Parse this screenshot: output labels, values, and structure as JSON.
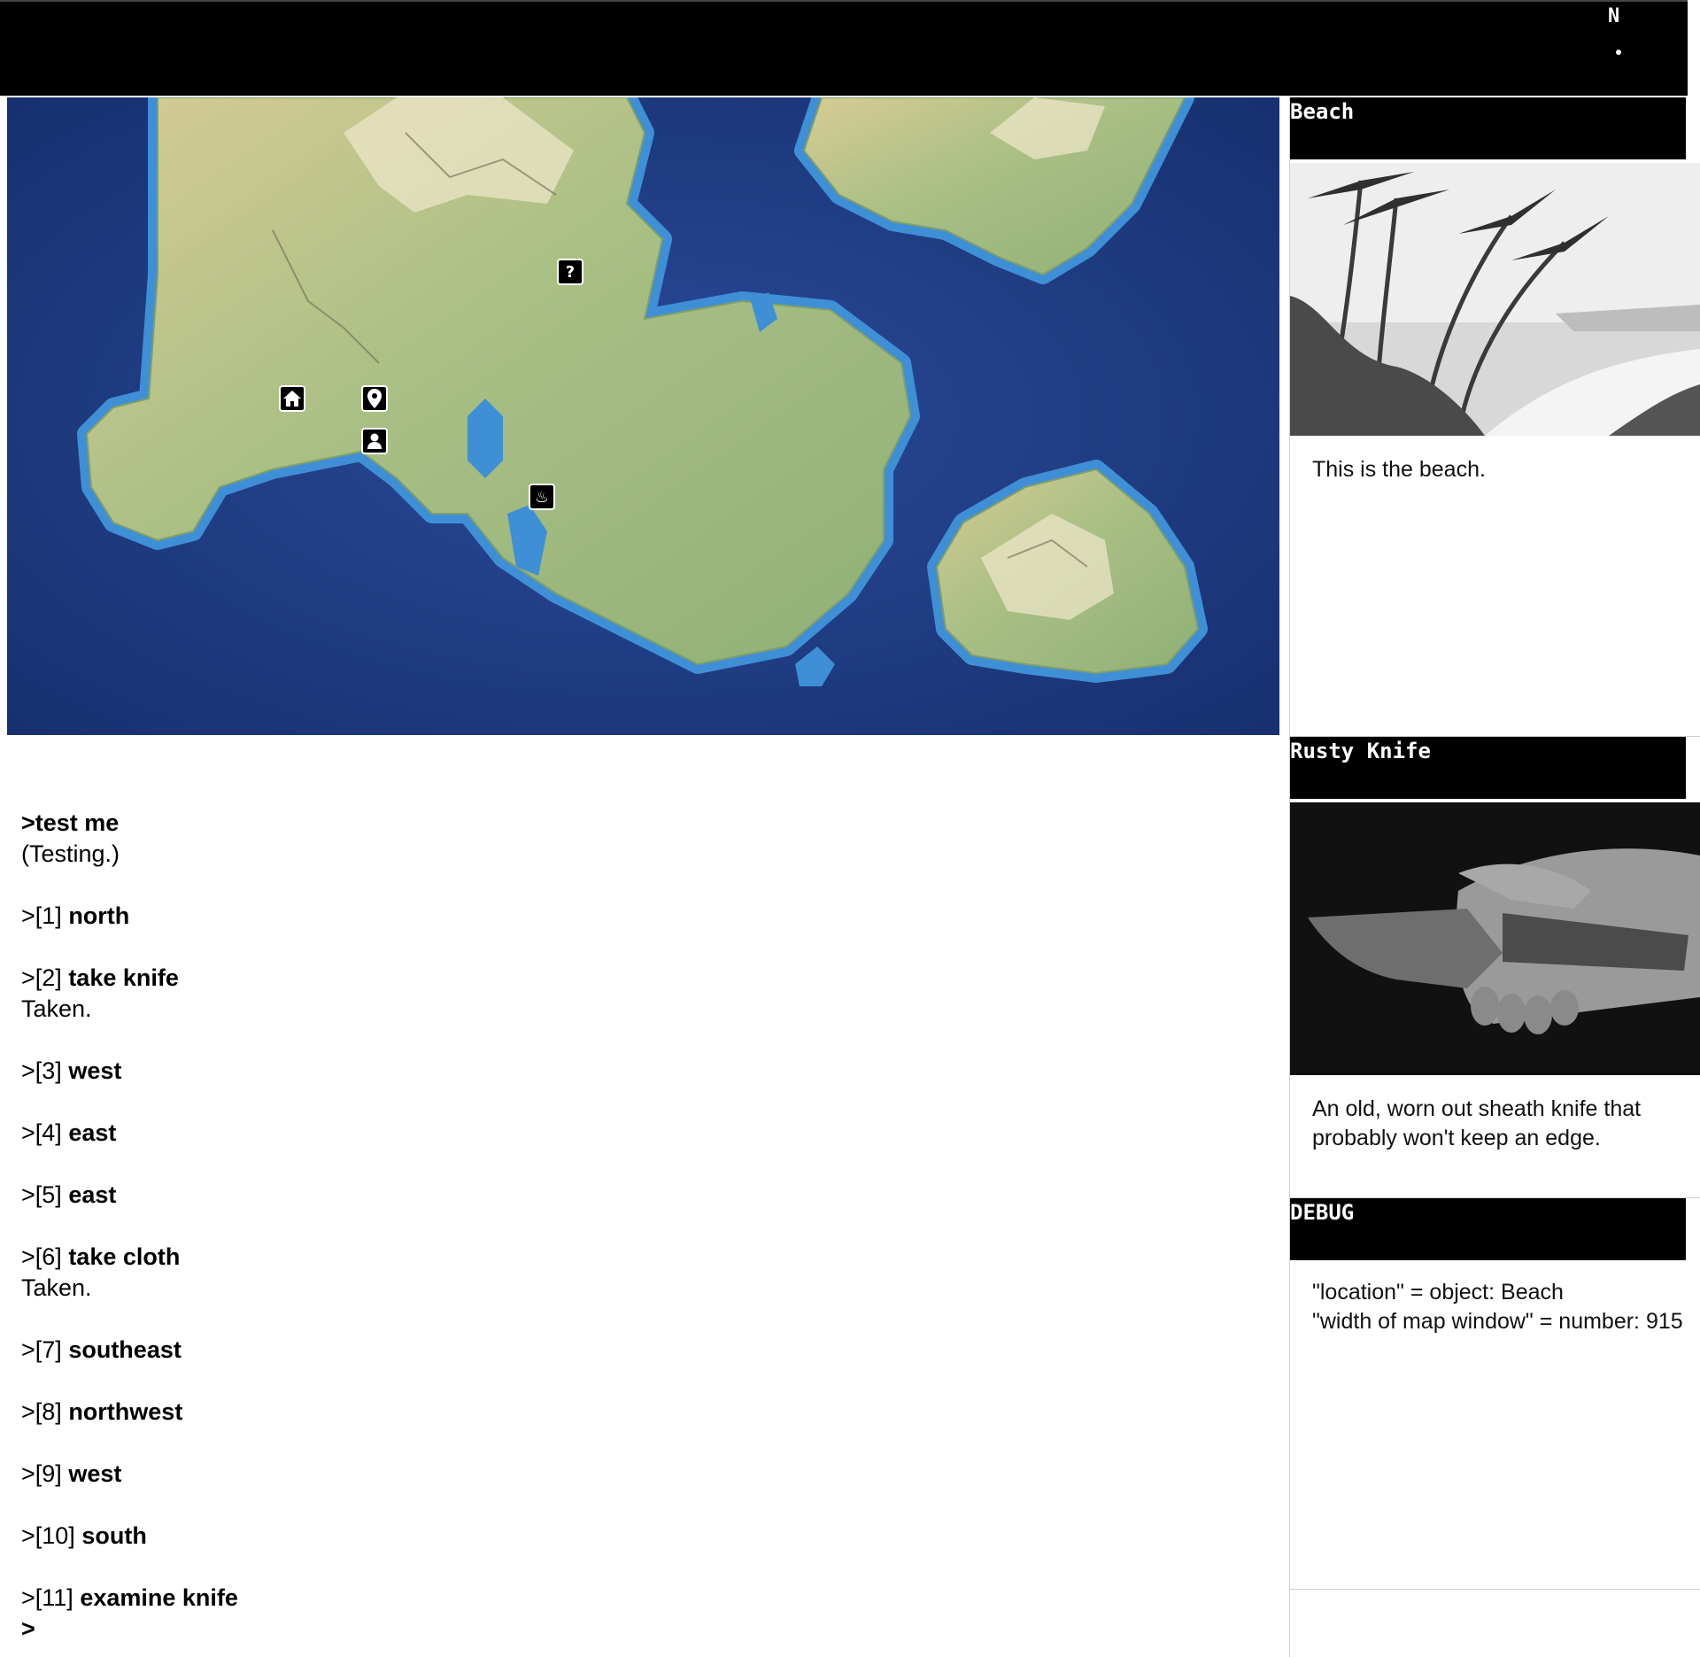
{
  "status_bar": {
    "compass_label": "N"
  },
  "map": {
    "markers": [
      {
        "name": "home-icon",
        "glyph": ""
      },
      {
        "name": "location-pin-icon",
        "glyph": ""
      },
      {
        "name": "person-icon",
        "glyph": ""
      },
      {
        "name": "question-icon",
        "glyph": "?"
      },
      {
        "name": "hot-spring-icon",
        "glyph": "♨"
      }
    ]
  },
  "panels": {
    "location": {
      "title": "Beach",
      "description": "This is the beach."
    },
    "item": {
      "title": "Rusty Knife",
      "description": "An old, worn out sheath knife that probably won't keep an edge."
    },
    "debug": {
      "title": "DEBUG",
      "line1": "\"location\" = object: Beach",
      "line2": "\"width of map window\" = number: 915"
    }
  },
  "transcript": {
    "first_command": ">test me",
    "first_response": "(Testing.)",
    "steps": [
      {
        "num": ">[1]",
        "cmd": "north",
        "response": ""
      },
      {
        "num": ">[2]",
        "cmd": "take knife",
        "response": "Taken."
      },
      {
        "num": ">[3]",
        "cmd": "west",
        "response": ""
      },
      {
        "num": ">[4]",
        "cmd": "east",
        "response": ""
      },
      {
        "num": ">[5]",
        "cmd": "east",
        "response": ""
      },
      {
        "num": ">[6]",
        "cmd": "take cloth",
        "response": "Taken."
      },
      {
        "num": ">[7]",
        "cmd": "southeast",
        "response": ""
      },
      {
        "num": ">[8]",
        "cmd": "northwest",
        "response": ""
      },
      {
        "num": ">[9]",
        "cmd": "west",
        "response": ""
      },
      {
        "num": ">[10]",
        "cmd": "south",
        "response": ""
      },
      {
        "num": ">[11]",
        "cmd": "examine knife",
        "response": ""
      }
    ],
    "prompt": ">"
  }
}
